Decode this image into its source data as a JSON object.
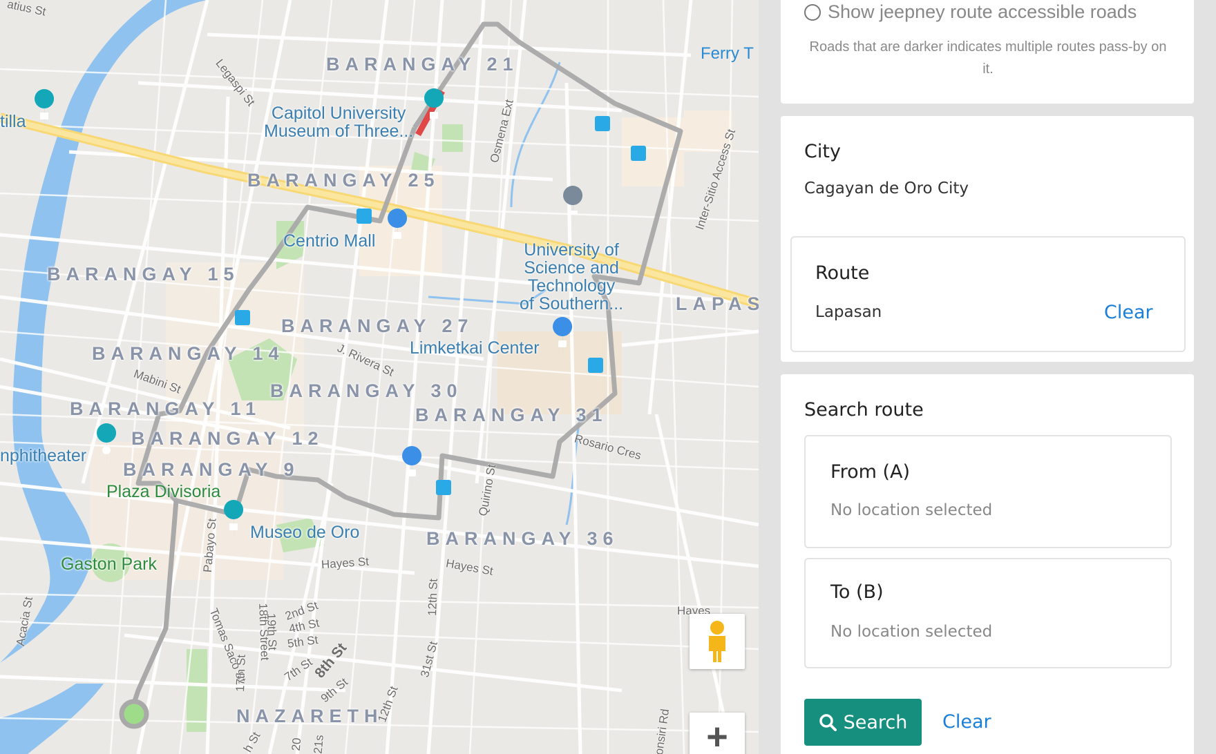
{
  "map": {
    "barangays": [
      "BARANGAY 21",
      "BARANGAY 25",
      "BARANGAY 15",
      "BARANGAY 27",
      "BARANGAY 14",
      "BARANGAY 30",
      "BARANGAY 11",
      "BARANGAY 31",
      "BARANGAY 12",
      "BARANGAY 9",
      "BARANGAY 36",
      "NAZARETH",
      "LAPAS"
    ],
    "pois": {
      "capitol": "Capitol University\nMuseum of Three...",
      "centrio": "Centrio Mall",
      "ustp": "University of\nScience and\nTechnology\nof Southern...",
      "limketkai": "Limketkai Center",
      "museo": "Museo de Oro",
      "plaza": "Plaza Divisoria",
      "gaston": "Gaston Park",
      "amphitheater": "nphitheater",
      "tilla": "tilla",
      "ferry": "Ferry T"
    },
    "streets": [
      "atius St",
      "Legaspi St",
      "Osmena Ext",
      "Inter-Sitio Access St",
      "J. Rivera St",
      "Mabini St",
      "Rosario Cres",
      "Quirino St",
      "Pabayo St",
      "Hayes St",
      "Hayes St",
      "12th St",
      "31st St",
      "Acacia St",
      "Tomas Saco St",
      "17th St",
      "18th Street",
      "19th St",
      "2nd St",
      "4th St",
      "5th St",
      "7th St",
      "8th St",
      "9th St",
      "12th St",
      "Hayes",
      "onsiri Rd",
      "20",
      "21s",
      "h St"
    ],
    "controls": {
      "pegman_icon": "pegman-icon",
      "zoom_in_label": "+"
    }
  },
  "sidebar": {
    "toggle": {
      "label": "Show jeepney route accessible roads"
    },
    "note": "Roads that are darker indicates multiple routes pass-by on it.",
    "city": {
      "heading": "City",
      "value": "Cagayan de Oro City"
    },
    "route": {
      "heading": "Route",
      "value": "Lapasan",
      "clear_label": "Clear"
    },
    "search": {
      "heading": "Search route",
      "from": {
        "label": "From (A)",
        "value": "No location selected"
      },
      "to": {
        "label": "To (B)",
        "value": "No location selected"
      },
      "search_label": "Search",
      "clear_label": "Clear"
    }
  },
  "colors": {
    "route_gray": "#a9a9a9",
    "route_red": "#e04848",
    "accent": "#168f7e",
    "link": "#1a7fd9",
    "river": "#8fc2ef"
  }
}
